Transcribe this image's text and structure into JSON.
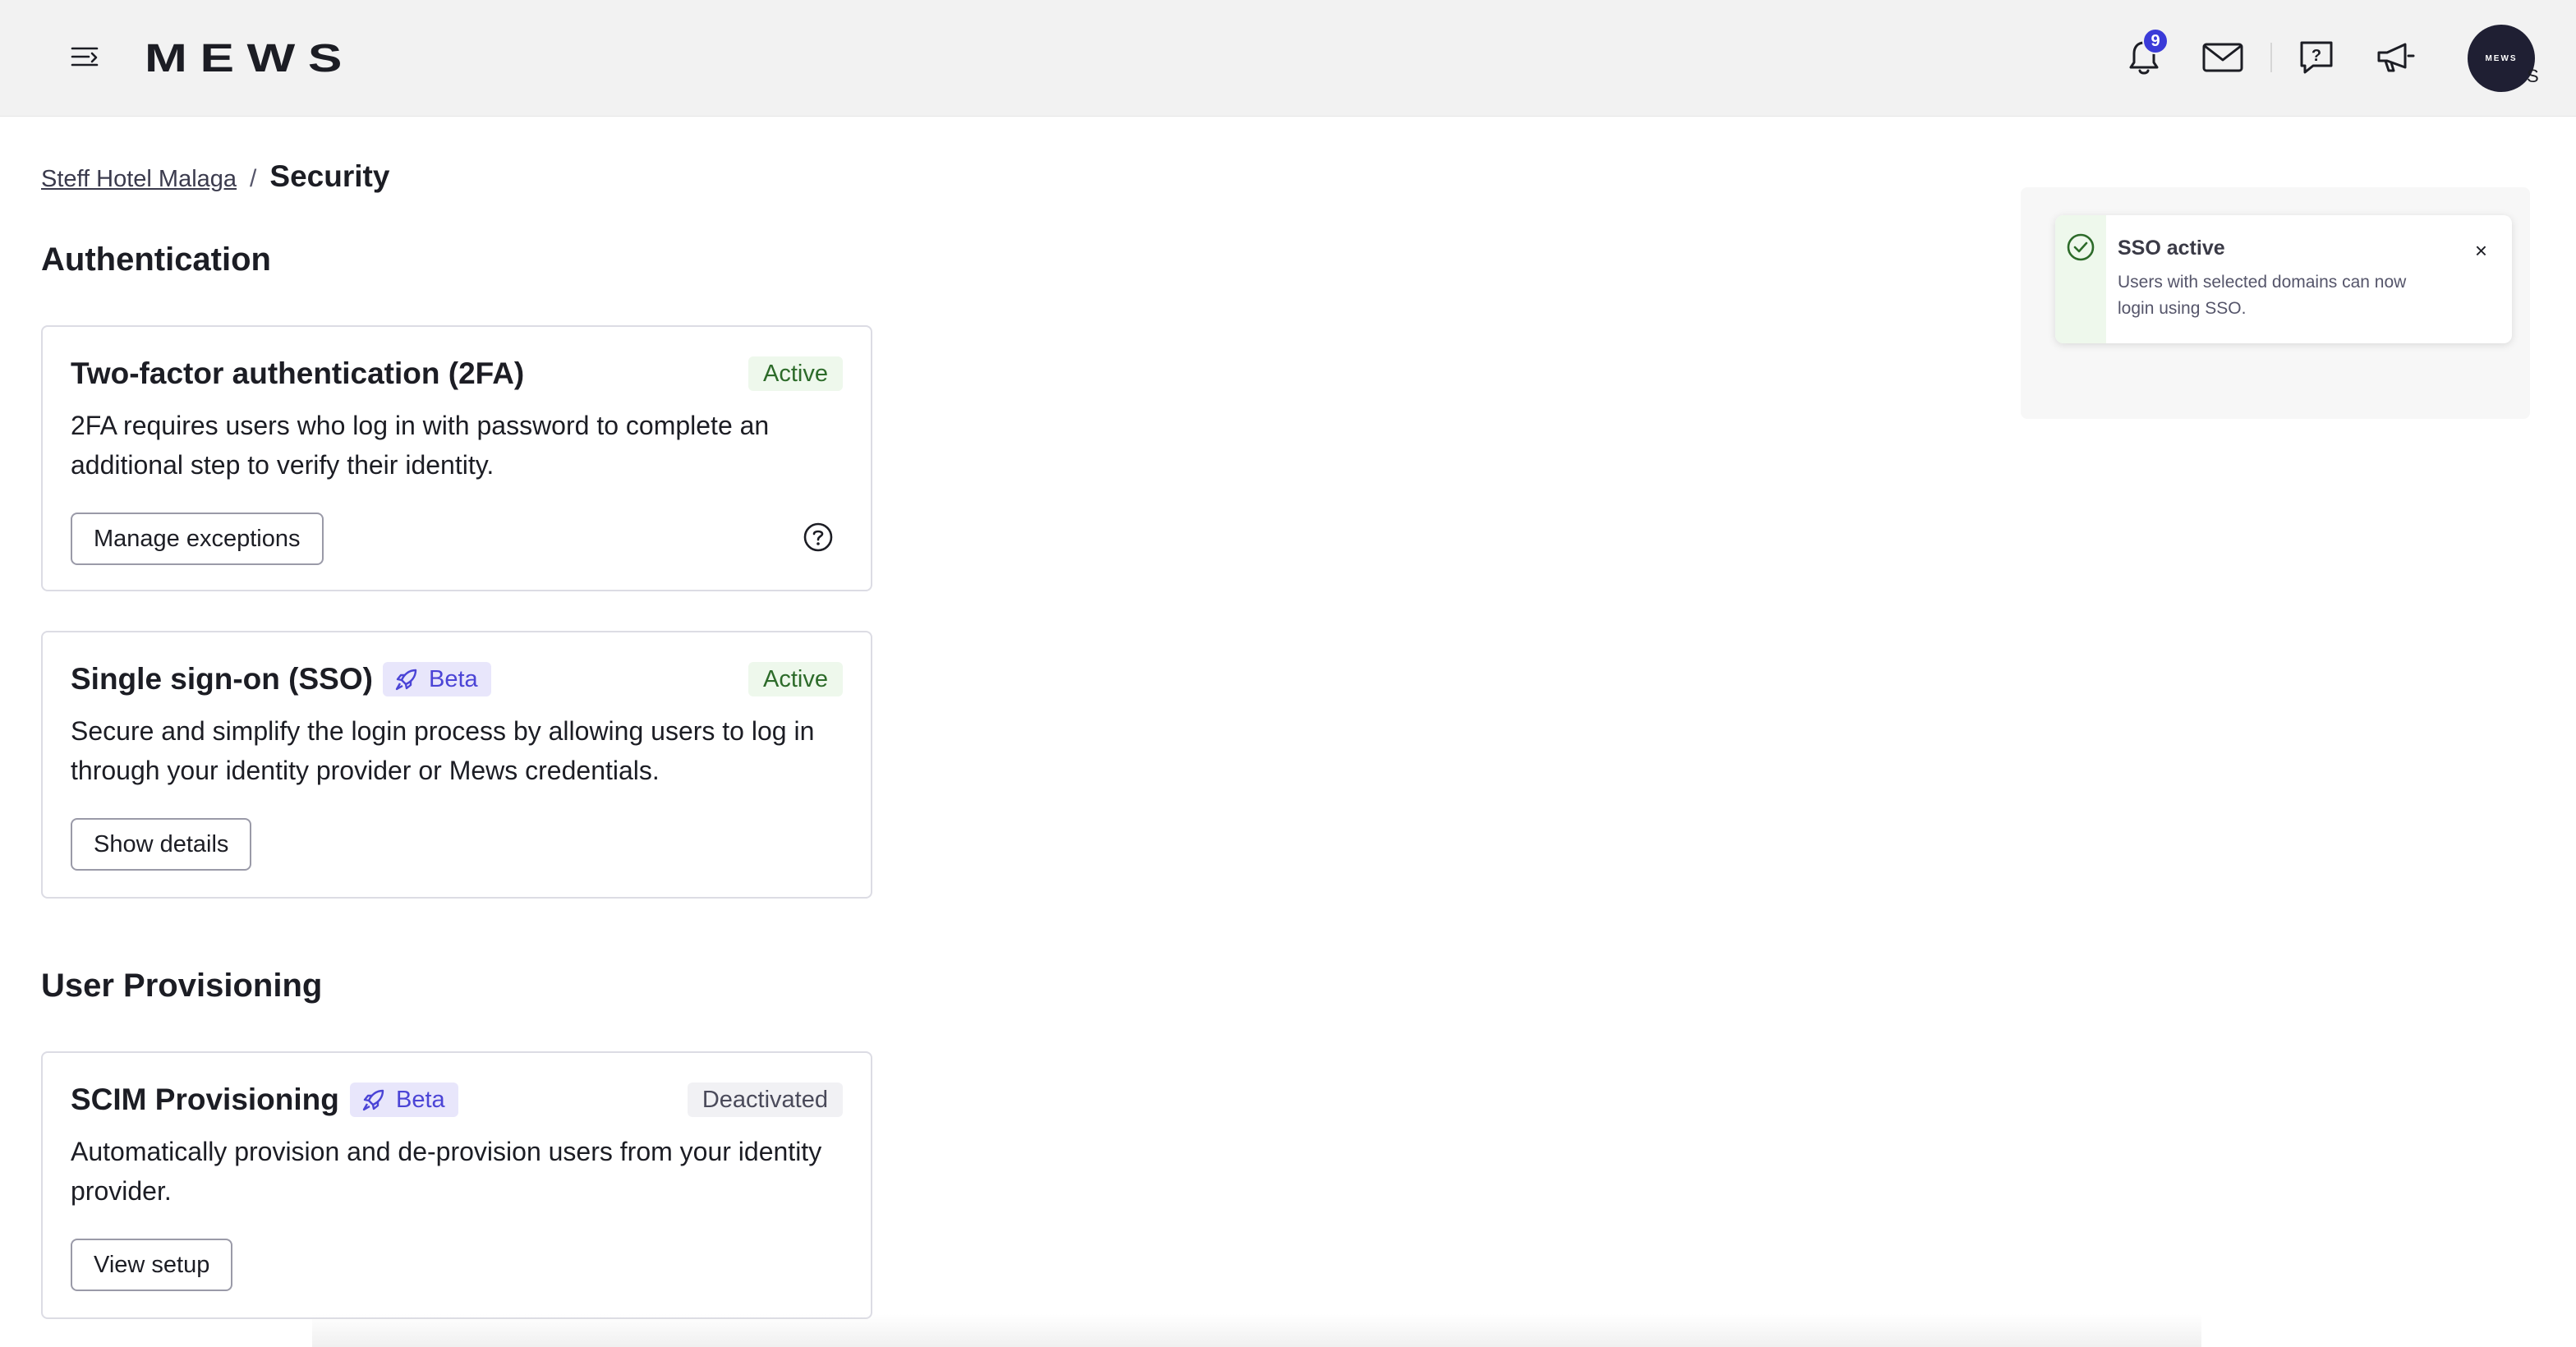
{
  "header": {
    "logo_text": "MEWS",
    "notification_count": "9",
    "avatar_text": "MEWS",
    "avatar_initial": "S",
    "icons": [
      "menu-icon",
      "bell-icon",
      "mail-icon",
      "help-chat-icon",
      "megaphone-icon"
    ]
  },
  "breadcrumb": {
    "parent": "Steff Hotel Malaga",
    "separator": "/",
    "current": "Security"
  },
  "authentication": {
    "title": "Authentication",
    "two_factor": {
      "title": "Two-factor authentication (2FA)",
      "status": "Active",
      "description": "2FA requires users who log in with password to complete an additional step to verify their identity.",
      "button": "Manage exceptions"
    },
    "sso": {
      "title": "Single sign-on (SSO)",
      "beta": "Beta",
      "status": "Active",
      "description": "Secure and simplify the login process by allowing users to log in through your identity provider or Mews credentials.",
      "button": "Show details"
    }
  },
  "provisioning": {
    "title": "User Provisioning",
    "scim": {
      "title": "SCIM Provisioning",
      "beta": "Beta",
      "status": "Deactivated",
      "description": "Automatically provision and de-provision users from your identity provider.",
      "button": "View setup"
    }
  },
  "toast": {
    "title": "SSO active",
    "body": "Users with selected domains can now login using SSO.",
    "close": "×"
  },
  "colors": {
    "accent": "#3b3bd8",
    "active_bg": "#eef8ec",
    "active_text": "#2d6b2a",
    "beta_bg": "#e8e6fb",
    "beta_text": "#4b44d6"
  }
}
